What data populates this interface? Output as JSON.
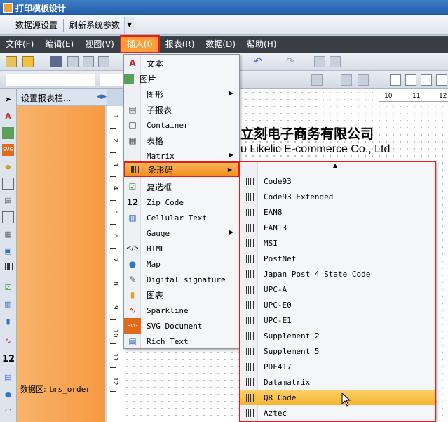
{
  "window": {
    "title": "打印模板设计"
  },
  "top_toolbar": {
    "datasource": "数据源设置",
    "refresh": "刷新系统参数"
  },
  "menubar": [
    {
      "label": "文件(F)"
    },
    {
      "label": "编辑(E)"
    },
    {
      "label": "视图(V)"
    },
    {
      "label": "插入(I)"
    },
    {
      "label": "报表(R)"
    },
    {
      "label": "数据(D)"
    },
    {
      "label": "帮助(H)"
    }
  ],
  "band_panel": {
    "header": "设置报表栏...",
    "data_label": "数据区:",
    "data_source": "tms_order"
  },
  "canvas": {
    "company_cn": "立刻电子商务有限公司",
    "company_en": "u Likelic E-commerce Co., Ltd"
  },
  "hruler": [
    "10",
    "11",
    "12"
  ],
  "vruler": [
    "1",
    "2",
    "3",
    "4",
    "5",
    "6",
    "7",
    "8",
    "9",
    "10",
    "11",
    "12"
  ],
  "insert_menu": [
    {
      "label": "文本",
      "icon": "text-icon"
    },
    {
      "label": "图片",
      "icon": "image-icon"
    },
    {
      "label": "图形",
      "icon": "shape-icon",
      "submenu": true
    },
    {
      "label": "子报表",
      "icon": "subreport-icon"
    },
    {
      "label": "Container",
      "icon": "container-icon"
    },
    {
      "label": "表格",
      "icon": "table-icon"
    },
    {
      "label": "Matrix",
      "icon": "matrix-icon",
      "submenu": true
    },
    {
      "label": "条形码",
      "icon": "barcode-icon",
      "submenu": true,
      "highlighted": true
    },
    {
      "label": "复选框",
      "icon": "checkbox-icon"
    },
    {
      "label": "Zip Code",
      "icon": "zipcode-icon"
    },
    {
      "label": "Cellular Text",
      "icon": "cellular-text-icon"
    },
    {
      "label": "Gauge",
      "icon": "gauge-icon",
      "submenu": true
    },
    {
      "label": "HTML",
      "icon": "html-icon"
    },
    {
      "label": "Map",
      "icon": "map-icon"
    },
    {
      "label": "Digital signature",
      "icon": "signature-icon"
    },
    {
      "label": "图表",
      "icon": "chart-icon"
    },
    {
      "label": "Sparkline",
      "icon": "sparkline-icon"
    },
    {
      "label": "SVG Document",
      "icon": "svg-icon"
    },
    {
      "label": "Rich Text",
      "icon": "richtext-icon"
    }
  ],
  "barcode_menu": [
    "Code93",
    "Code93 Extended",
    "EAN8",
    "EAN13",
    "MSI",
    "PostNet",
    "Japan Post 4 State Code",
    "UPC-A",
    "UPC-E0",
    "UPC-E1",
    "Supplement 2",
    "Supplement 5",
    "PDF417",
    "Datamatrix",
    "QR Code",
    "Aztec"
  ],
  "barcode_highlighted": "QR Code",
  "colors": {
    "accent": "#f48d1f",
    "highlight_border": "#e21e1e",
    "band": "#f59a42"
  }
}
